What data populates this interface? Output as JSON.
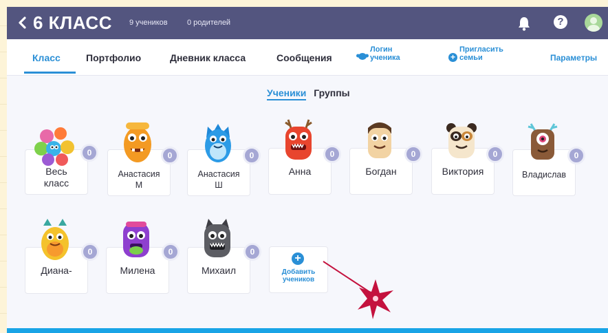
{
  "header": {
    "back_icon": "chevron-left-icon",
    "class_name": "6 КЛАСС",
    "students_count": "9 учеников",
    "parents_count": "0 родителей",
    "icons": [
      "bell-icon",
      "help-icon",
      "avatar"
    ],
    "help_glyph": "?"
  },
  "tabs": {
    "class": "Класс",
    "portfolio": "Портфолио",
    "diary": "Дневник класса",
    "messages": "Сообщения",
    "student_login_line1": "Логин",
    "student_login_line2": "ученика",
    "invite_line1": "Пригласить",
    "invite_line2": "семьи",
    "settings": "Параметры"
  },
  "subtabs": {
    "students": "Ученики",
    "groups": "Группы"
  },
  "students": [
    {
      "name": "Весь",
      "name2": "класс",
      "points": "0",
      "monster": "whole-class-group"
    },
    {
      "name": "Анастасия",
      "name2": "М",
      "points": "0",
      "monster": "orange"
    },
    {
      "name": "Анастасия",
      "name2": "Ш",
      "points": "0",
      "monster": "blue"
    },
    {
      "name": "Анна",
      "name2": "",
      "points": "0",
      "monster": "red"
    },
    {
      "name": "Богдан",
      "name2": "",
      "points": "0",
      "monster": "beige"
    },
    {
      "name": "Виктория",
      "name2": "",
      "points": "0",
      "monster": "panda"
    },
    {
      "name": "Владислав",
      "name2": "",
      "points": "0",
      "monster": "cyclops"
    },
    {
      "name": "Диана-",
      "name2": "",
      "points": "0",
      "monster": "yellow"
    },
    {
      "name": "Милена",
      "name2": "",
      "points": "0",
      "monster": "purple"
    },
    {
      "name": "Михаил",
      "name2": "",
      "points": "0",
      "monster": "gray"
    }
  ],
  "add_students": {
    "line1": "Добавить",
    "line2": "учеников",
    "icon": "plus-icon"
  },
  "colors": {
    "header_bg": "#53557f",
    "accent": "#2a8fd6",
    "badge": "#a5a7d4",
    "bottom_bar": "#19a4e6",
    "pointer": "#c4123e"
  }
}
